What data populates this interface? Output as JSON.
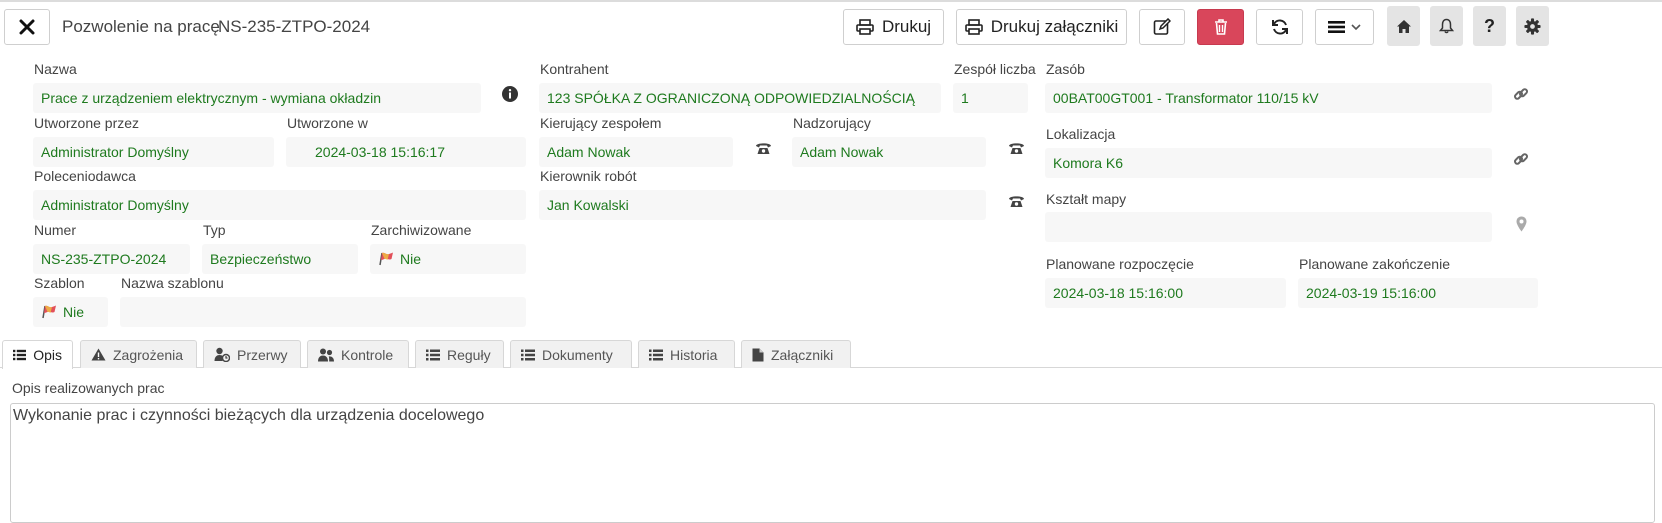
{
  "header": {
    "title": "Pozwolenie na pracę",
    "number": "NS-235-ZTPO-2024",
    "print_label": "Drukuj",
    "print_attachments_label": "Drukuj załączniki"
  },
  "form": {
    "nazwa": {
      "label": "Nazwa",
      "value": "Prace z urządzeniem elektrycznym - wymiana okładzin"
    },
    "kontrahent": {
      "label": "Kontrahent",
      "value": "123 SPÓŁKA Z OGRANICZONĄ ODPOWIEDZIALNOŚCIĄ"
    },
    "zespol_liczba": {
      "label": "Zespół liczba",
      "value": "1"
    },
    "zasob": {
      "label": "Zasób",
      "value": "00BAT00GT001 - Transformator 110/15 kV"
    },
    "utworzone_przez": {
      "label": "Utworzone przez",
      "value": "Administrator Domyślny"
    },
    "utworzone_w": {
      "label": "Utworzone w",
      "value": "2024-03-18 15:16:17"
    },
    "kierujacy": {
      "label": "Kierujący zespołem",
      "value": "Adam Nowak"
    },
    "nadzorujacy": {
      "label": "Nadzorujący",
      "value": "Adam Nowak"
    },
    "lokalizacja": {
      "label": "Lokalizacja",
      "value": "Komora K6"
    },
    "polecenidawca": {
      "label": "Poleceniodawca",
      "value": "Administrator Domyślny"
    },
    "kierownik": {
      "label": "Kierownik robót",
      "value": "Jan Kowalski"
    },
    "ksztalt_mapy": {
      "label": "Kształt mapy",
      "value": ""
    },
    "numer": {
      "label": "Numer",
      "value": "NS-235-ZTPO-2024"
    },
    "typ": {
      "label": "Typ",
      "value": "Bezpieczeństwo"
    },
    "zarchiwizowane": {
      "label": "Zarchiwizowane",
      "value": "Nie"
    },
    "planowane_rozpoczecie": {
      "label": "Planowane rozpoczęcie",
      "value": "2024-03-18 15:16:00"
    },
    "planowane_zakonczenie": {
      "label": "Planowane zakończenie",
      "value": "2024-03-19 15:16:00"
    },
    "szablon": {
      "label": "Szablon",
      "value": "Nie"
    },
    "nazwa_szablonu": {
      "label": "Nazwa szablonu",
      "value": ""
    }
  },
  "tabs": [
    {
      "label": "Opis",
      "icon": "list-icon",
      "active": true
    },
    {
      "label": "Zagrożenia",
      "icon": "warning-icon"
    },
    {
      "label": "Przerwy",
      "icon": "user-clock-icon"
    },
    {
      "label": "Kontrole",
      "icon": "users-icon"
    },
    {
      "label": "Reguły",
      "icon": "list-icon"
    },
    {
      "label": "Dokumenty",
      "icon": "list-icon"
    },
    {
      "label": "Historia",
      "icon": "list-icon"
    },
    {
      "label": "Załączniki",
      "icon": "file-icon"
    }
  ],
  "description": {
    "label": "Opis realizowanych prac",
    "value": "Wykonanie prac i czynności bieżących dla urządzenia docelowego"
  },
  "colors": {
    "value_text": "#1e7a1e",
    "danger": "#d9465b",
    "field_bg": "#f7f7f7"
  }
}
